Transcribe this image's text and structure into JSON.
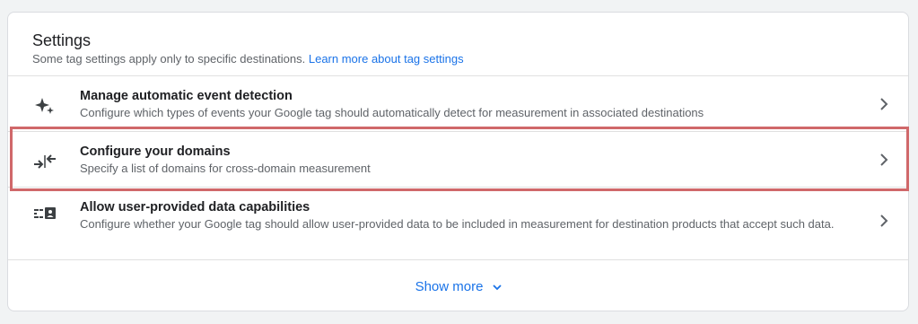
{
  "settings": {
    "title": "Settings",
    "subtitle": "Some tag settings apply only to specific destinations.",
    "learn_more": "Learn more about tag settings"
  },
  "rows": [
    {
      "title": "Manage automatic event detection",
      "description": "Configure which types of events your Google tag should automatically detect for measurement in associated destinations",
      "icon": "sparkle-icon"
    },
    {
      "title": "Configure your domains",
      "description": "Specify a list of domains for cross-domain measurement",
      "icon": "merge-arrows-icon"
    },
    {
      "title": "Allow user-provided data capabilities",
      "description": "Configure whether your Google tag should allow user-provided data to be included in measurement for destination products that accept such data.",
      "icon": "user-data-icon"
    }
  ],
  "show_more": {
    "label": "Show more",
    "icon": "chevron-down-icon"
  },
  "colors": {
    "accent": "#1a73e8",
    "highlight": "#d0686a",
    "text": "#202124",
    "muted": "#5f6368"
  }
}
